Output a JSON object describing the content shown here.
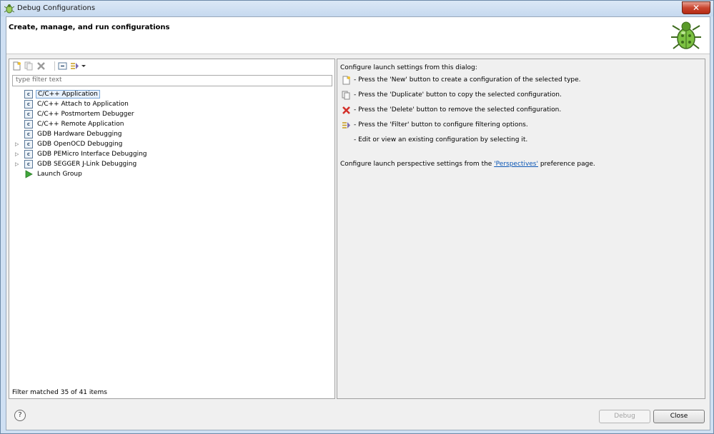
{
  "window": {
    "title": "Debug Configurations",
    "close_glyph": "✕"
  },
  "banner": {
    "title": "Create, manage, and run configurations"
  },
  "toolbar": {
    "icons": [
      "new-configuration-icon",
      "duplicate-icon",
      "delete-icon",
      "collapse-all-icon",
      "filter-icon",
      "dropdown-arrow-icon"
    ]
  },
  "filter": {
    "placeholder": "type filter text",
    "value": ""
  },
  "tree": {
    "items": [
      {
        "label": "C/C++ Application",
        "expandable": false,
        "selected": true,
        "icon": "c-icon"
      },
      {
        "label": "C/C++ Attach to Application",
        "expandable": false,
        "selected": false,
        "icon": "c-icon"
      },
      {
        "label": "C/C++ Postmortem Debugger",
        "expandable": false,
        "selected": false,
        "icon": "c-icon"
      },
      {
        "label": "C/C++ Remote Application",
        "expandable": false,
        "selected": false,
        "icon": "c-icon"
      },
      {
        "label": "GDB Hardware Debugging",
        "expandable": false,
        "selected": false,
        "icon": "c-icon"
      },
      {
        "label": "GDB OpenOCD Debugging",
        "expandable": true,
        "selected": false,
        "icon": "c-icon"
      },
      {
        "label": "GDB PEMicro Interface Debugging",
        "expandable": true,
        "selected": false,
        "icon": "c-icon"
      },
      {
        "label": "GDB SEGGER J-Link Debugging",
        "expandable": true,
        "selected": false,
        "icon": "c-icon"
      },
      {
        "label": "Launch Group",
        "expandable": false,
        "selected": false,
        "icon": "launch-group-icon"
      }
    ],
    "c_glyph": "c",
    "expander_glyph": "▷"
  },
  "status": {
    "text": "Filter matched 35 of 41 items"
  },
  "right": {
    "intro": "Configure launch settings from this dialog:",
    "rows": [
      {
        "icon": "new-icon",
        "text": "- Press the 'New' button to create a configuration of the selected type."
      },
      {
        "icon": "duplicate-icon",
        "text": "- Press the 'Duplicate' button to copy the selected configuration."
      },
      {
        "icon": "delete-icon",
        "text": "- Press the 'Delete' button to remove the selected configuration."
      },
      {
        "icon": "filter-icon",
        "text": "- Press the 'Filter' button to configure filtering options."
      },
      {
        "icon": "",
        "text": "- Edit or view an existing configuration by selecting it."
      }
    ],
    "perspectives_prefix": "Configure launch perspective settings from the ",
    "perspectives_link": "'Perspectives'",
    "perspectives_suffix": " preference page."
  },
  "footer": {
    "help_glyph": "?",
    "debug_label": "Debug",
    "close_label": "Close"
  },
  "colors": {
    "accent": "#0b56b5",
    "selection": "#e8f1fb",
    "close_red": "#c9452f"
  }
}
